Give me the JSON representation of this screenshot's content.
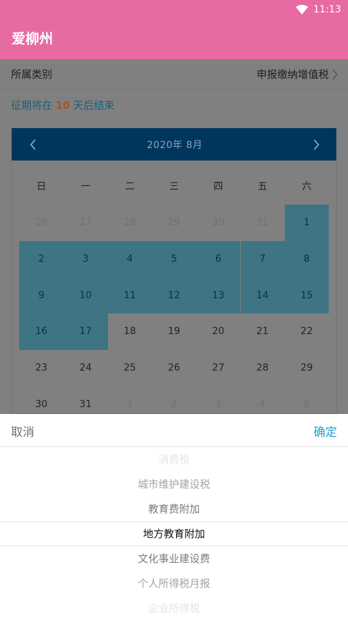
{
  "status_bar": {
    "time": "11:13",
    "wifi_icon": "wifi-icon"
  },
  "header": {
    "title": "爱柳州",
    "color": "#e86aa3"
  },
  "form": {
    "category_label": "所属类别",
    "category_value": "申报缴纳增值税",
    "deadline": {
      "prefix": "征期将在 ",
      "days": "10",
      "suffix": " 天后结束"
    }
  },
  "calendar": {
    "title": "2020年  8月",
    "weekdays": [
      "日",
      "一",
      "二",
      "三",
      "四",
      "五",
      "六"
    ],
    "weeks": [
      [
        {
          "d": "26",
          "t": "other"
        },
        {
          "d": "27",
          "t": "other"
        },
        {
          "d": "28",
          "t": "other"
        },
        {
          "d": "29",
          "t": "other"
        },
        {
          "d": "30",
          "t": "other"
        },
        {
          "d": "31",
          "t": "other"
        },
        {
          "d": "1",
          "t": "sel"
        }
      ],
      [
        {
          "d": "2",
          "t": "sel"
        },
        {
          "d": "3",
          "t": "sel"
        },
        {
          "d": "4",
          "t": "sel"
        },
        {
          "d": "5",
          "t": "sel"
        },
        {
          "d": "6",
          "t": "sel"
        },
        {
          "d": "7",
          "t": "sel"
        },
        {
          "d": "8",
          "t": "sel"
        }
      ],
      [
        {
          "d": "9",
          "t": "sel"
        },
        {
          "d": "10",
          "t": "sel"
        },
        {
          "d": "11",
          "t": "sel"
        },
        {
          "d": "12",
          "t": "sel"
        },
        {
          "d": "13",
          "t": "sel"
        },
        {
          "d": "14",
          "t": "sel"
        },
        {
          "d": "15",
          "t": "sel"
        }
      ],
      [
        {
          "d": "16",
          "t": "sel"
        },
        {
          "d": "17",
          "t": "sel"
        },
        {
          "d": "18",
          "t": "cur"
        },
        {
          "d": "19",
          "t": "cur"
        },
        {
          "d": "20",
          "t": "cur"
        },
        {
          "d": "21",
          "t": "cur"
        },
        {
          "d": "22",
          "t": "cur"
        }
      ],
      [
        {
          "d": "23",
          "t": "cur"
        },
        {
          "d": "24",
          "t": "cur"
        },
        {
          "d": "25",
          "t": "cur"
        },
        {
          "d": "26",
          "t": "cur"
        },
        {
          "d": "27",
          "t": "cur"
        },
        {
          "d": "28",
          "t": "cur"
        },
        {
          "d": "29",
          "t": "cur"
        }
      ],
      [
        {
          "d": "30",
          "t": "cur"
        },
        {
          "d": "31",
          "t": "cur"
        },
        {
          "d": "1",
          "t": "other"
        },
        {
          "d": "2",
          "t": "other"
        },
        {
          "d": "3",
          "t": "other"
        },
        {
          "d": "4",
          "t": "other"
        },
        {
          "d": "5",
          "t": "other"
        }
      ]
    ],
    "header_color": "#00365c",
    "selected_color": "#3e7484"
  },
  "picker": {
    "cancel_label": "取消",
    "confirm_label": "确定",
    "confirm_color": "#1aa2d3",
    "options": [
      "消费税",
      "城市维护建设税",
      "教育费附加",
      "地方教育附加",
      "文化事业建设费",
      "个人所得税月报",
      "企业所得税"
    ],
    "selected_index": 3
  }
}
